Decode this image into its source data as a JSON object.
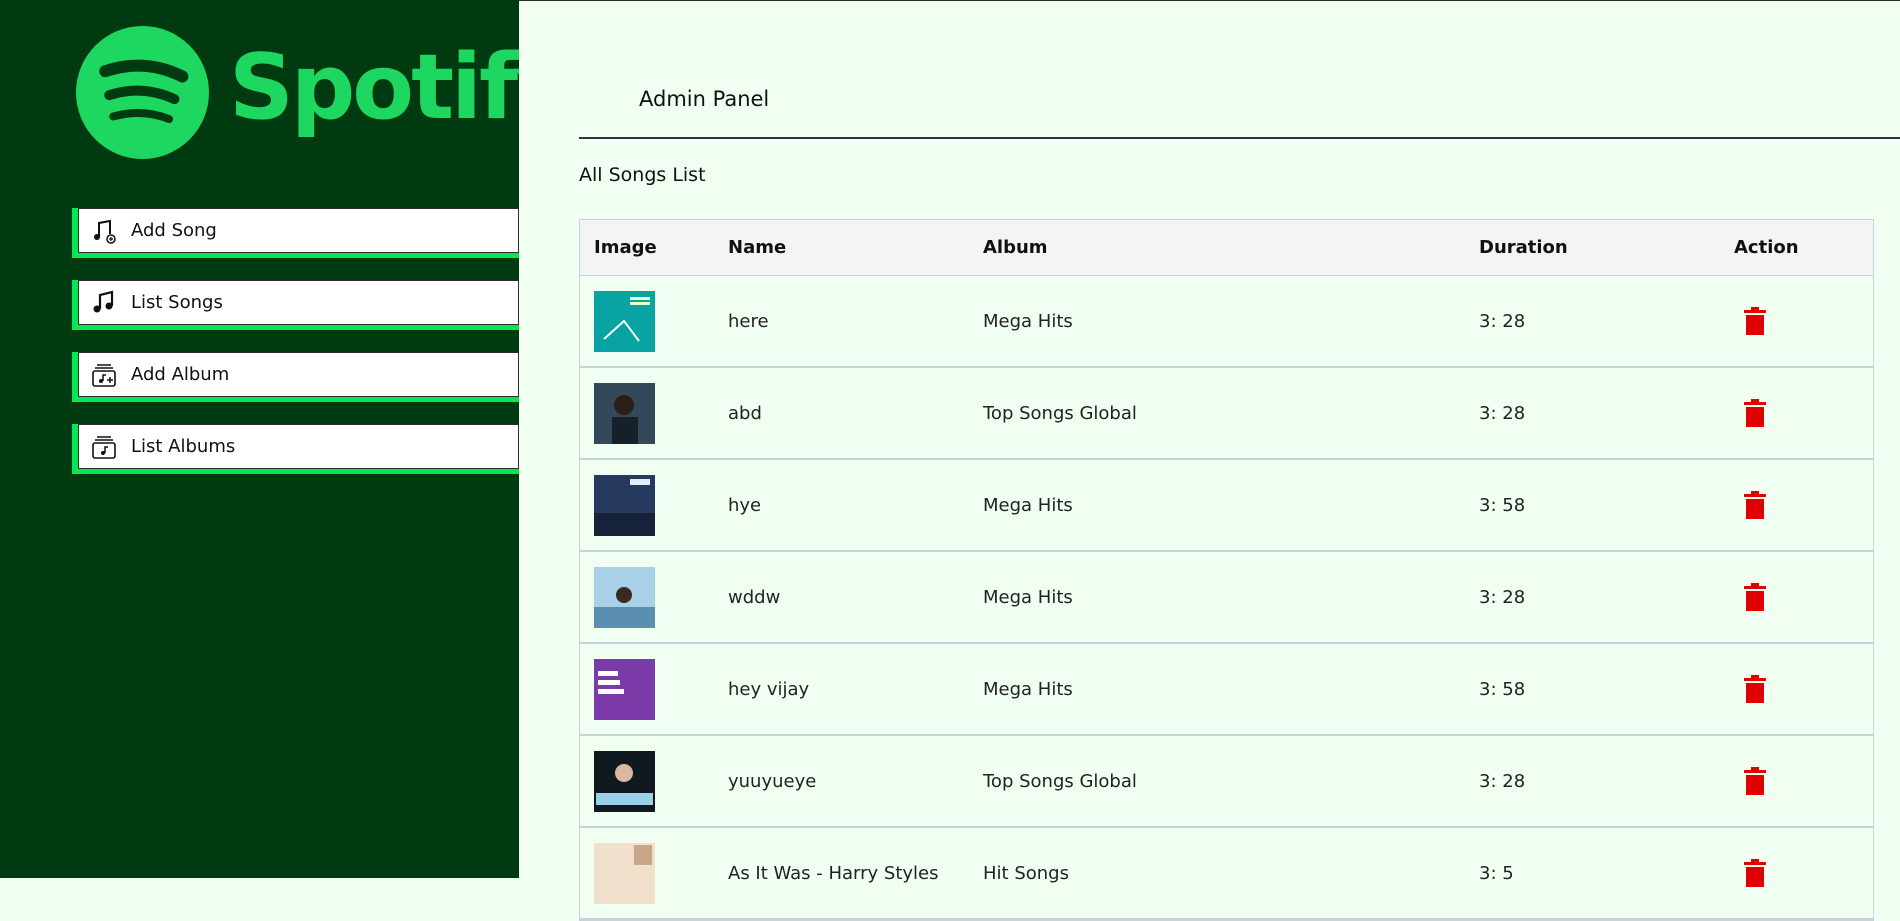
{
  "brand": {
    "name": "Spotify",
    "reg": "®"
  },
  "nav": [
    {
      "label": "Add Song",
      "icon": "add-song-icon"
    },
    {
      "label": "List Songs",
      "icon": "music-note-icon"
    },
    {
      "label": "Add Album",
      "icon": "add-album-icon"
    },
    {
      "label": "List Albums",
      "icon": "album-icon"
    }
  ],
  "header": {
    "title": "Admin Panel"
  },
  "main": {
    "section_title": "All Songs List",
    "columns": [
      "Image",
      "Name",
      "Album",
      "Duration",
      "Action"
    ],
    "rows": [
      {
        "name": "here",
        "album": "Mega Hits",
        "duration": "3: 28"
      },
      {
        "name": "abd",
        "album": "Top Songs Global",
        "duration": "3: 28"
      },
      {
        "name": "hye",
        "album": "Mega Hits",
        "duration": "3: 58"
      },
      {
        "name": "wddw",
        "album": "Mega Hits",
        "duration": "3: 28"
      },
      {
        "name": "hey vijay",
        "album": "Mega Hits",
        "duration": "3: 58"
      },
      {
        "name": "yuuyueye",
        "album": "Top Songs Global",
        "duration": "3: 28"
      },
      {
        "name": "As It Was - Harry Styles",
        "album": "Hit Songs",
        "duration": "3: 5"
      }
    ]
  },
  "colors": {
    "sidebar": "#003a10",
    "accent": "#1ed760",
    "delete": "#e00000"
  }
}
